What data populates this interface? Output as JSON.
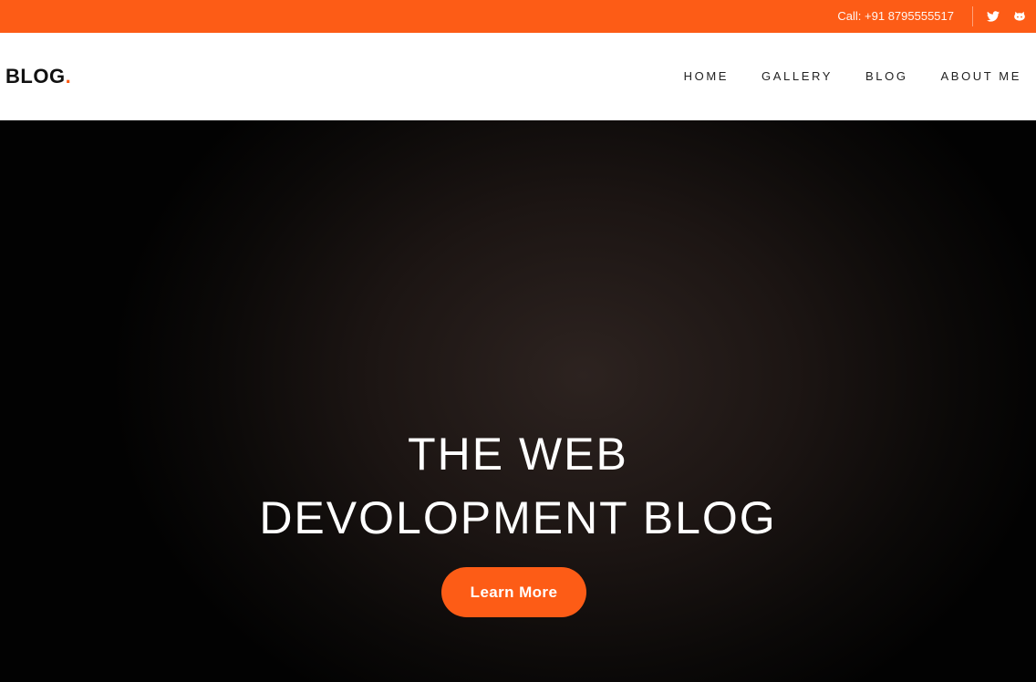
{
  "topbar": {
    "call_text": "Call: +91 8795555517",
    "social_icons": [
      "twitter-icon",
      "github-icon"
    ],
    "background_color": "#fd5c16"
  },
  "header": {
    "brand": "BLOG",
    "brand_dot": ".",
    "nav": [
      {
        "label": "HOME"
      },
      {
        "label": "GALLERY"
      },
      {
        "label": "BLOG"
      },
      {
        "label": "ABOUT ME"
      }
    ]
  },
  "hero": {
    "title_line1": "THE WEB",
    "title_line2": "DEVOLOPMENT BLOG",
    "cta_label": "Learn More",
    "accent_color": "#fd5c16"
  }
}
